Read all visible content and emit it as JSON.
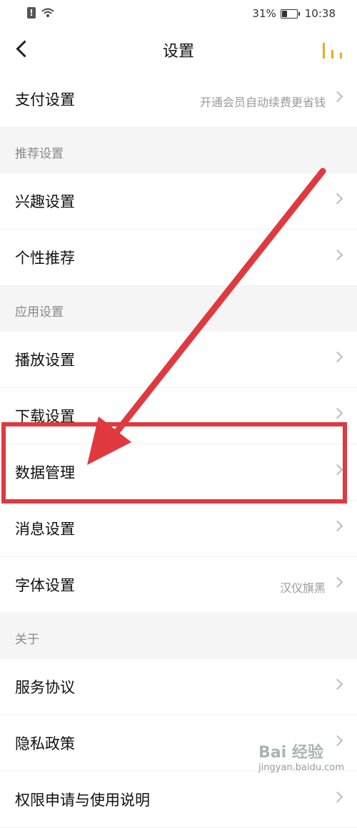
{
  "status_bar": {
    "battery": "31%",
    "time": "10:38",
    "battery_level": 0.31
  },
  "header": {
    "title": "设置"
  },
  "rows": [
    {
      "type": "item",
      "label": "支付设置",
      "value": "开通会员自动续费更省钱"
    },
    {
      "type": "section",
      "label": "推荐设置"
    },
    {
      "type": "item",
      "label": "兴趣设置"
    },
    {
      "type": "item",
      "label": "个性推荐"
    },
    {
      "type": "section",
      "label": "应用设置"
    },
    {
      "type": "item",
      "label": "播放设置"
    },
    {
      "type": "item",
      "label": "下载设置"
    },
    {
      "type": "item",
      "label": "数据管理"
    },
    {
      "type": "item",
      "label": "消息设置"
    },
    {
      "type": "item",
      "label": "字体设置",
      "value": "汉仪旗黑"
    },
    {
      "type": "section",
      "label": "关于"
    },
    {
      "type": "item",
      "label": "服务协议"
    },
    {
      "type": "item",
      "label": "隐私政策"
    },
    {
      "type": "item",
      "label": "权限申请与使用说明"
    }
  ],
  "watermark": {
    "line1": "Bai 经验",
    "line2": "jingyan.baidu.com"
  },
  "colors": {
    "accent": "#f0a81a",
    "annotation": "#e0393f"
  }
}
